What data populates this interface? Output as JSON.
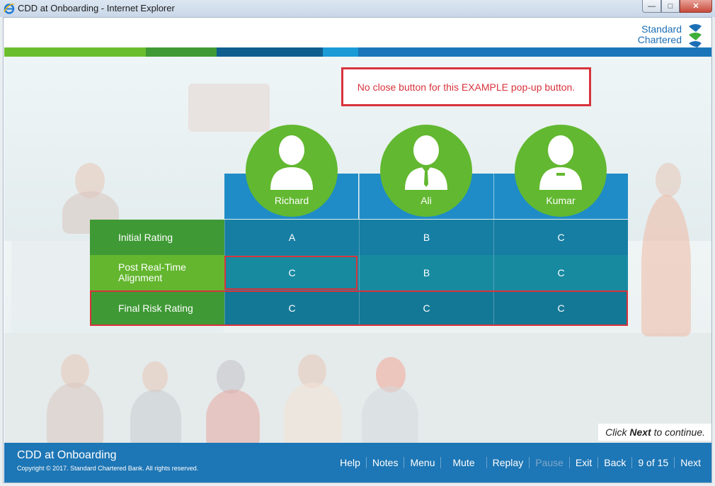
{
  "window": {
    "title": "CDD at Onboarding - Internet Explorer"
  },
  "header": {
    "logo_line1": "Standard",
    "logo_line2": "Chartered",
    "colorbar": [
      "#6abe2e",
      "#3f9a35",
      "#0f5f8e",
      "#1a9ad6",
      "#1a76b8"
    ]
  },
  "callout": {
    "text": "No close button for this EXAMPLE pop-up button."
  },
  "table": {
    "columns": [
      {
        "name": "Richard",
        "icon": "person-icon"
      },
      {
        "name": "Ali",
        "icon": "businessman-icon"
      },
      {
        "name": "Kumar",
        "icon": "person-badge-icon"
      }
    ],
    "rows": [
      {
        "label": "Initial Rating",
        "values": [
          "A",
          "B",
          "C"
        ]
      },
      {
        "label": "Post Real-Time Alignment",
        "values": [
          "C",
          "B",
          "C"
        ]
      },
      {
        "label": "Final Risk Rating",
        "values": [
          "C",
          "C",
          "C"
        ]
      }
    ]
  },
  "hint": {
    "prefix": "Click ",
    "bold": "Next",
    "suffix": " to continue."
  },
  "footer": {
    "title": "CDD at Onboarding",
    "copyright": "Copyright © 2017. Standard Chartered Bank. All rights reserved.",
    "nav": {
      "help": "Help",
      "notes": "Notes",
      "menu": "Menu",
      "mute": "Mute",
      "replay": "Replay",
      "pause": "Pause",
      "exit": "Exit",
      "back": "Back",
      "page": "9 of 15",
      "next": "Next"
    }
  }
}
